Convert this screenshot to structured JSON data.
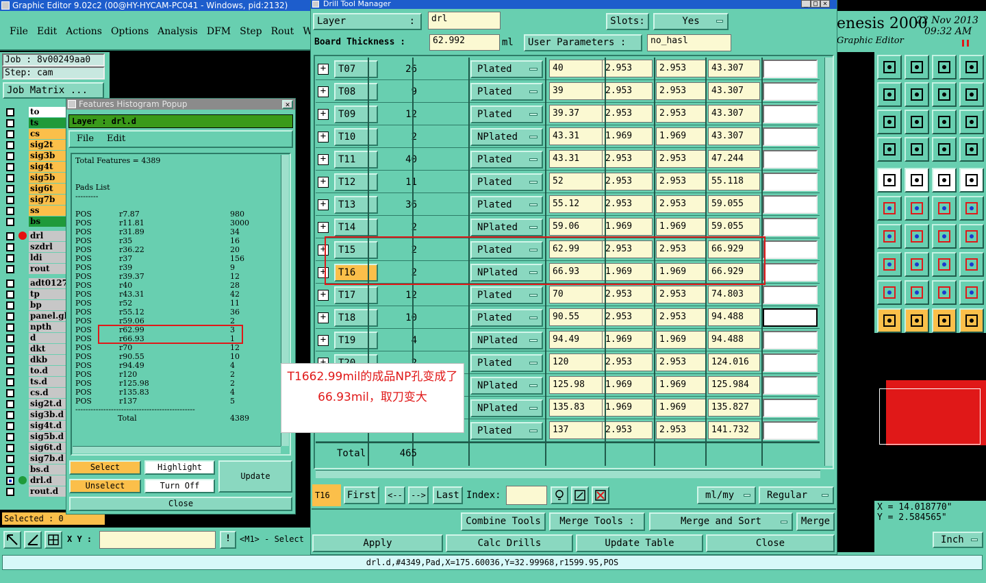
{
  "main_window": {
    "title": "Graphic Editor 9.02c2 (00@HY-HYCAM-PC041 - Windows, pid:2132)",
    "menu": [
      "File",
      "Edit",
      "Actions",
      "Options",
      "Analysis",
      "DFM",
      "Step",
      "Rout",
      "W"
    ],
    "job_label": "Job : 8v00249aa0",
    "step_label": "Step: cam",
    "job_matrix_button": "Job Matrix ...",
    "selected_label": "Selected : 0",
    "xy_label": "X Y :",
    "hint_text": "<M1> - Select",
    "status_bar": "drl.d,#4349,Pad,X=175.60036,Y=32.99968,r1599.95,POS",
    "brand": "enesis 2000",
    "brand_sub": "Graphic Editor",
    "date": "22 Nov 2013",
    "time": "09:32 AM",
    "coord_x": "X = 14.018770\"",
    "coord_y": "Y = 2.584565\"",
    "unit_select": "Inch"
  },
  "layers_a": [
    {
      "name": "to",
      "color": "#ffffff"
    },
    {
      "name": "ts",
      "color": "#1f9a3a"
    },
    {
      "name": "cs",
      "color": "#fbbf4a"
    },
    {
      "name": "sig2t",
      "color": "#fbbf4a"
    },
    {
      "name": "sig3b",
      "color": "#fbbf4a"
    },
    {
      "name": "sig4t",
      "color": "#fbbf4a"
    },
    {
      "name": "sig5b",
      "color": "#fbbf4a"
    },
    {
      "name": "sig6t",
      "color": "#fbbf4a"
    },
    {
      "name": "sig7b",
      "color": "#fbbf4a"
    },
    {
      "name": "ss",
      "color": "#fbbf4a"
    },
    {
      "name": "bs",
      "color": "#1f9a3a"
    }
  ],
  "layers_b": [
    {
      "name": "drl",
      "color": "#c7c7c7",
      "dot": "#e51010"
    },
    {
      "name": "szdrl",
      "color": "#c7c7c7"
    },
    {
      "name": "ldi",
      "color": "#c7c7c7"
    },
    {
      "name": "rout",
      "color": "#c7c7c7"
    }
  ],
  "layers_c": [
    {
      "name": "adt0127",
      "color": "#c7c7c7"
    },
    {
      "name": "tp",
      "color": "#c7c7c7"
    },
    {
      "name": "bp",
      "color": "#c7c7c7"
    },
    {
      "name": "panel.gl",
      "color": "#c7c7c7"
    },
    {
      "name": "npth",
      "color": "#c7c7c7"
    },
    {
      "name": "d",
      "color": "#c7c7c7"
    },
    {
      "name": "dkt",
      "color": "#c7c7c7"
    },
    {
      "name": "dkb",
      "color": "#c7c7c7"
    },
    {
      "name": "to.d",
      "color": "#c7c7c7"
    },
    {
      "name": "ts.d",
      "color": "#c7c7c7"
    },
    {
      "name": "cs.d",
      "color": "#c7c7c7"
    },
    {
      "name": "sig2t.d",
      "color": "#c7c7c7"
    },
    {
      "name": "sig3b.d",
      "color": "#c7c7c7"
    },
    {
      "name": "sig4t.d",
      "color": "#c7c7c7"
    },
    {
      "name": "sig5b.d",
      "color": "#c7c7c7"
    },
    {
      "name": "sig6t.d",
      "color": "#c7c7c7"
    },
    {
      "name": "sig7b.d",
      "color": "#c7c7c7"
    },
    {
      "name": "bs.d",
      "color": "#c7c7c7"
    },
    {
      "name": "drl.d",
      "color": "#c7c7c7",
      "dot": "#1f9a3a",
      "selected": true
    },
    {
      "name": "rout.d",
      "color": "#c7c7c7"
    }
  ],
  "histogram": {
    "title": "Features Histogram Popup",
    "layer_label": "Layer :  drl.d",
    "menu": [
      "File",
      "Edit"
    ],
    "total_features": "Total Features = 4389",
    "pads_list": "Pads List",
    "pads_rule": "---------",
    "rows": [
      [
        "POS",
        "r7.87",
        "980"
      ],
      [
        "POS",
        "r11.81",
        "3000"
      ],
      [
        "POS",
        "r31.89",
        "34"
      ],
      [
        "POS",
        "r35",
        "16"
      ],
      [
        "POS",
        "r36.22",
        "20"
      ],
      [
        "POS",
        "r37",
        "156"
      ],
      [
        "POS",
        "r39",
        "9"
      ],
      [
        "POS",
        "r39.37",
        "12"
      ],
      [
        "POS",
        "r40",
        "28"
      ],
      [
        "POS",
        "r43.31",
        "42"
      ],
      [
        "POS",
        "r52",
        "11"
      ],
      [
        "POS",
        "r55.12",
        "36"
      ],
      [
        "POS",
        "r59.06",
        "2"
      ],
      [
        "POS",
        "r62.99",
        "3"
      ],
      [
        "POS",
        "r66.93",
        "1"
      ],
      [
        "POS",
        "r70",
        "12"
      ],
      [
        "POS",
        "r90.55",
        "10"
      ],
      [
        "POS",
        "r94.49",
        "4"
      ],
      [
        "POS",
        "r120",
        "2"
      ],
      [
        "POS",
        "r125.98",
        "2"
      ],
      [
        "POS",
        "r135.83",
        "4"
      ],
      [
        "POS",
        "r137",
        "5"
      ]
    ],
    "rule": "-----------------------------------------------",
    "total_label": "Total",
    "total_value": "4389",
    "buttons": {
      "select": "Select",
      "highlight": "Highlight",
      "update": "Update",
      "unselect": "Unselect",
      "turn_off": "Turn Off",
      "close": "Close"
    }
  },
  "drill": {
    "title": "Drill Tool Manager",
    "layer_label": "Layer",
    "layer_value": "drl",
    "slots_label": "Slots:",
    "slots_value": "Yes",
    "thickness_label": "Board Thickness :",
    "thickness_value": "62.992",
    "thickness_unit": "ml",
    "user_params_label": "User Parameters :",
    "user_params_value": "no_hasl",
    "rows": [
      {
        "tool": "T07",
        "count": "26",
        "type": "Plated",
        "finish": "40",
        "tol_p": "2.953",
        "tol_m": "2.953",
        "drill": "43.307"
      },
      {
        "tool": "T08",
        "count": "9",
        "type": "Plated",
        "finish": "39",
        "tol_p": "2.953",
        "tol_m": "2.953",
        "drill": "43.307"
      },
      {
        "tool": "T09",
        "count": "12",
        "type": "Plated",
        "finish": "39.37",
        "tol_p": "2.953",
        "tol_m": "2.953",
        "drill": "43.307"
      },
      {
        "tool": "T10",
        "count": "2",
        "type": "NPlated",
        "finish": "43.31",
        "tol_p": "1.969",
        "tol_m": "1.969",
        "drill": "43.307"
      },
      {
        "tool": "T11",
        "count": "40",
        "type": "Plated",
        "finish": "43.31",
        "tol_p": "2.953",
        "tol_m": "2.953",
        "drill": "47.244"
      },
      {
        "tool": "T12",
        "count": "11",
        "type": "Plated",
        "finish": "52",
        "tol_p": "2.953",
        "tol_m": "2.953",
        "drill": "55.118"
      },
      {
        "tool": "T13",
        "count": "36",
        "type": "Plated",
        "finish": "55.12",
        "tol_p": "2.953",
        "tol_m": "2.953",
        "drill": "59.055"
      },
      {
        "tool": "T14",
        "count": "2",
        "type": "NPlated",
        "finish": "59.06",
        "tol_p": "1.969",
        "tol_m": "1.969",
        "drill": "59.055"
      },
      {
        "tool": "T15",
        "count": "2",
        "type": "Plated",
        "finish": "62.99",
        "tol_p": "2.953",
        "tol_m": "2.953",
        "drill": "66.929"
      },
      {
        "tool": "T16",
        "count": "2",
        "type": "NPlated",
        "finish": "66.93",
        "tol_p": "1.969",
        "tol_m": "1.969",
        "drill": "66.929"
      },
      {
        "tool": "T17",
        "count": "12",
        "type": "Plated",
        "finish": "70",
        "tol_p": "2.953",
        "tol_m": "2.953",
        "drill": "74.803"
      },
      {
        "tool": "T18",
        "count": "10",
        "type": "Plated",
        "finish": "90.55",
        "tol_p": "2.953",
        "tol_m": "2.953",
        "drill": "94.488"
      },
      {
        "tool": "T19",
        "count": "4",
        "type": "NPlated",
        "finish": "94.49",
        "tol_p": "1.969",
        "tol_m": "1.969",
        "drill": "94.488"
      },
      {
        "tool": "T20",
        "count": "2",
        "type": "Plated",
        "finish": "120",
        "tol_p": "2.953",
        "tol_m": "2.953",
        "drill": "124.016"
      },
      {
        "tool": "",
        "count": "",
        "type": "NPlated",
        "finish": "125.98",
        "tol_p": "1.969",
        "tol_m": "1.969",
        "drill": "125.984"
      },
      {
        "tool": "",
        "count": "",
        "type": "NPlated",
        "finish": "135.83",
        "tol_p": "1.969",
        "tol_m": "1.969",
        "drill": "135.827"
      },
      {
        "tool": "",
        "count": "",
        "type": "Plated",
        "finish": "137",
        "tol_p": "2.953",
        "tol_m": "2.953",
        "drill": "141.732"
      }
    ],
    "total_label": "Total",
    "total_value": "465",
    "current_tool": "T16",
    "nav": {
      "first": "First",
      "prev": "<--",
      "next": "-->",
      "last": "Last",
      "index_label": "Index:"
    },
    "units_select": "ml/my",
    "mode_select": "Regular",
    "combine_tools": "Combine Tools",
    "merge_tools_label": "Merge Tools :",
    "merge_sort": "Merge and Sort",
    "merge": "Merge",
    "apply": "Apply",
    "calc_drills": "Calc Drills",
    "update_table": "Update Table",
    "close": "Close"
  },
  "annotation": "T1662.99mil的成品NP孔变成了66.93mil，取刀变大",
  "colors": {
    "teal": "#68cfb0",
    "accent_yellow": "#fbbf4a",
    "highlight_red": "#e01818",
    "title_blue": "#1d5dcc"
  }
}
